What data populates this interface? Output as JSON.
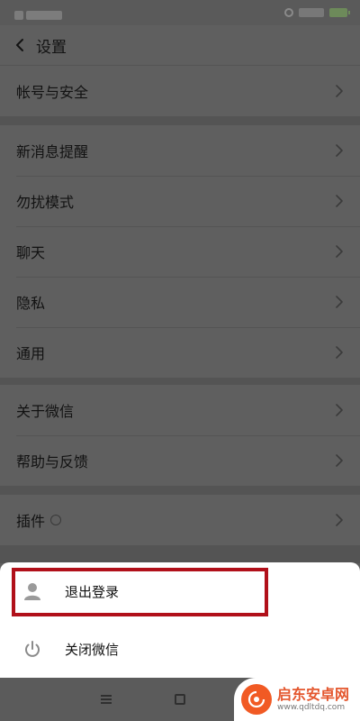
{
  "nav": {
    "title": "设置"
  },
  "groups": [
    {
      "items": [
        {
          "label": "帐号与安全"
        }
      ]
    },
    {
      "items": [
        {
          "label": "新消息提醒"
        },
        {
          "label": "勿扰模式"
        },
        {
          "label": "聊天"
        },
        {
          "label": "隐私"
        },
        {
          "label": "通用"
        }
      ]
    },
    {
      "items": [
        {
          "label": "关于微信"
        },
        {
          "label": "帮助与反馈"
        }
      ]
    },
    {
      "items": [
        {
          "label": "插件"
        }
      ]
    }
  ],
  "sheet": {
    "logout_label": "退出登录",
    "close_label": "关闭微信"
  },
  "watermark": {
    "title": "启东安卓网",
    "url": "www.qdltdq.com"
  },
  "colors": {
    "highlight": "#b1101a",
    "watermark_accent": "#f15a24"
  }
}
